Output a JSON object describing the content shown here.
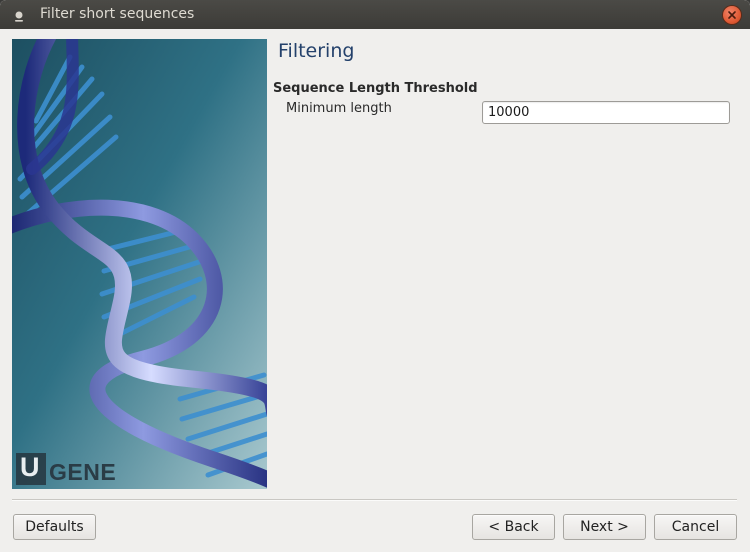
{
  "window": {
    "title": "Filter short sequences"
  },
  "page": {
    "title": "Filtering"
  },
  "section": {
    "label": "Sequence Length Threshold"
  },
  "fields": {
    "min_length_label": "Minimum length",
    "min_length_value": "10000"
  },
  "sidebar": {
    "logo_letter": "U",
    "logo_text": "GENE"
  },
  "buttons": {
    "defaults": "Defaults",
    "back": "< Back",
    "next": "Next >",
    "cancel": "Cancel"
  },
  "colors": {
    "title_accent": "#24416b",
    "close_button": "#e05a34",
    "image_teal": "#2e6c80"
  },
  "icons": {
    "window_menu": "window-menu-icon",
    "close": "close-icon"
  }
}
